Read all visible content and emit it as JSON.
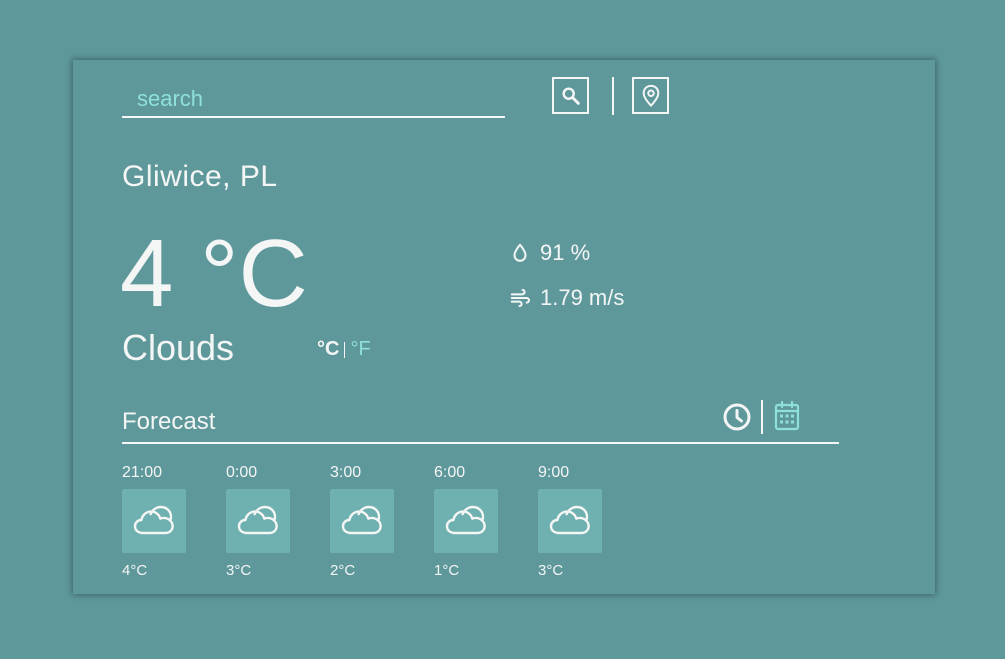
{
  "search": {
    "placeholder": "search",
    "value": ""
  },
  "icons": {
    "search_button": "search-icon",
    "location_button": "map-pin-icon",
    "humidity": "droplet-icon",
    "wind": "wind-icon",
    "hourly": "clock-icon",
    "daily": "calendar-icon",
    "weather": "cloud-icon"
  },
  "location": {
    "city": "Gliwice, PL"
  },
  "current": {
    "temperature": "4 °C",
    "condition": "Clouds",
    "humidity": "91 %",
    "wind": "1.79 m/s"
  },
  "units": {
    "celsius": "°C",
    "fahrenheit": "°F",
    "selected": "°C"
  },
  "forecast": {
    "title": "Forecast",
    "mode": "hourly",
    "items": [
      {
        "time": "21:00",
        "temp": "4°C",
        "icon": "cloud-icon"
      },
      {
        "time": "0:00",
        "temp": "3°C",
        "icon": "cloud-icon"
      },
      {
        "time": "3:00",
        "temp": "2°C",
        "icon": "cloud-icon"
      },
      {
        "time": "6:00",
        "temp": "1°C",
        "icon": "cloud-icon"
      },
      {
        "time": "9:00",
        "temp": "3°C",
        "icon": "cloud-icon"
      }
    ]
  },
  "colors": {
    "background": "#5e989b",
    "foreground": "#f4f6f6",
    "accent": "#8fe0dc",
    "tile": "#6fb0b0"
  }
}
